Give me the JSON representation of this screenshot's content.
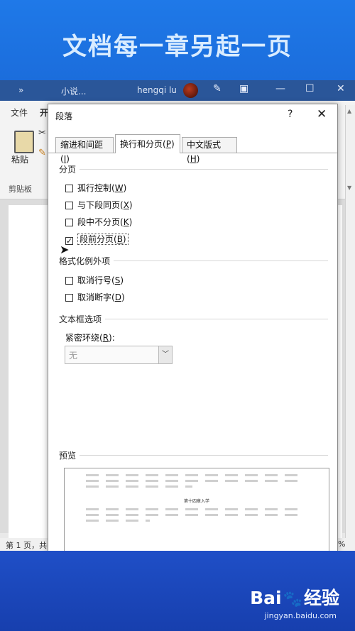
{
  "banner": {
    "title": "文档每一章另起一页"
  },
  "word": {
    "titlebar": {
      "chevrons": "»",
      "doc_name": "小说...",
      "user": "hengqi lu"
    },
    "ribbon_tabs": {
      "file": "文件",
      "start_fragment": "开"
    },
    "ribbon": {
      "paste_label": "粘贴",
      "clipboard_label": "剪贴板"
    },
    "statusbar": {
      "page_text": "第 1 页，共",
      "zoom_fragment": "%"
    }
  },
  "dialog": {
    "title": "段落",
    "help": "?",
    "close": "✕",
    "tabs": [
      {
        "label": "缩进和间距(I)",
        "key": "I",
        "before": "缩进和间距(",
        "after": ")"
      },
      {
        "label": "换行和分页(P)",
        "key": "P",
        "before": "换行和分页(",
        "after": ")"
      },
      {
        "label": "中文版式(H)",
        "key": "H",
        "before": "中文版式(",
        "after": ")"
      }
    ],
    "pagination": {
      "title": "分页",
      "options": [
        {
          "before": "孤行控制(",
          "key": "W",
          "after": ")",
          "checked": false
        },
        {
          "before": "与下段同页(",
          "key": "X",
          "after": ")",
          "checked": false
        },
        {
          "before": "段中不分页(",
          "key": "K",
          "after": ")",
          "checked": false
        },
        {
          "before": "段前分页(",
          "key": "B",
          "after": ")",
          "checked": true
        }
      ]
    },
    "format_exceptions": {
      "title": "格式化例外项",
      "options": [
        {
          "before": "取消行号(",
          "key": "S",
          "after": ")",
          "checked": false
        },
        {
          "before": "取消断字(",
          "key": "D",
          "after": ")",
          "checked": false
        }
      ]
    },
    "textbox_options": {
      "title": "文本框选项",
      "wrap_label_before": "紧密环绕(",
      "wrap_label_key": "R",
      "wrap_label_after": "):",
      "wrap_value": "无"
    },
    "preview": {
      "title": "预览",
      "heading": "第十四章入学"
    }
  },
  "watermark": {
    "brand_left": "Bai",
    "brand_right": "经验",
    "site": "jingyan.baidu.com"
  }
}
